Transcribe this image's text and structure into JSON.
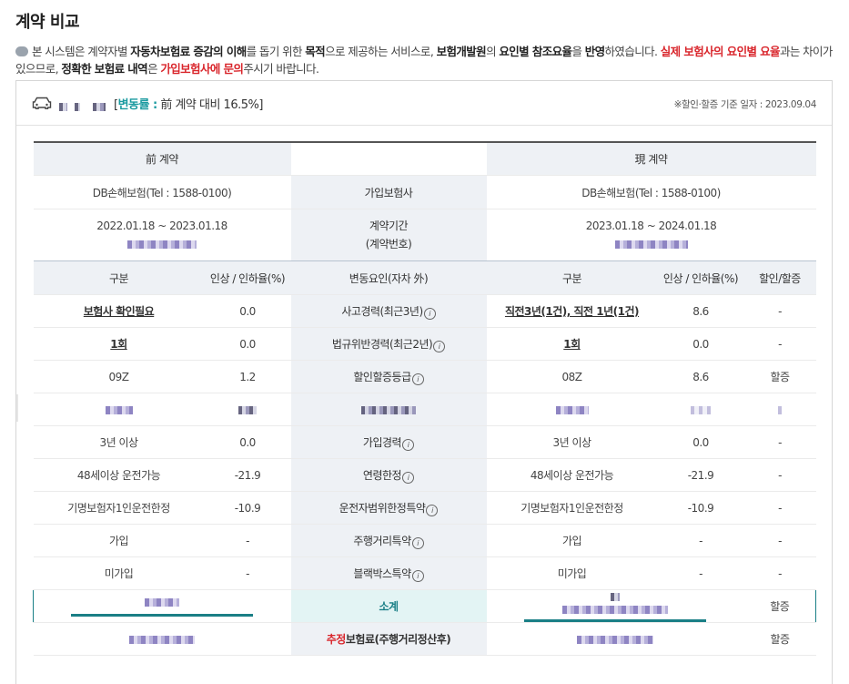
{
  "page": {
    "title": "계약 비교",
    "notice": {
      "t1": "본 시스템은 계약자별 ",
      "b1": "자동차보험료 증감의 이해",
      "t2": "를 돕기 위한 ",
      "b2": "목적",
      "t3": "으로 제공하는 서비스로, ",
      "b3": "보험개발원",
      "t4": "의 ",
      "b4": "요인별 참조요율",
      "t5": "을 ",
      "b5": "반영",
      "t6": "하였습니다. ",
      "r1": "실제 보험사의 요인별 요율",
      "t7": "과는 차이가 있으므로, ",
      "b6": "정확한 보험료 내역",
      "t8": "은 ",
      "r2": "가입보험사에 문의",
      "t9": "주시기 바랍니다."
    }
  },
  "summary": {
    "rate_prefix": "[",
    "rate_label": "변동률 :",
    "rate_text": " 前 계약 대비 16.5%]",
    "base_date": "※할인·할증 기준 일자 : 2023.09.04"
  },
  "headers": {
    "prev_contract": "前 계약",
    "curr_contract": "現 계약",
    "insurer_label": "가입보험사",
    "period_label_1": "계약기간",
    "period_label_2": "(계약번호)",
    "col_category": "구분",
    "col_rate": "인상 / 인하율(%)",
    "col_factor": "변동요인(자차 外)",
    "col_category_2": "구분",
    "col_rate_2": "인상 / 인하율(%)",
    "col_discount": "할인/할증"
  },
  "contracts": {
    "prev_insurer": "DB손해보험(Tel : 1588-0100)",
    "curr_insurer": "DB손해보험(Tel : 1588-0100)",
    "prev_period": "2022.01.18 ~ 2023.01.18",
    "curr_period": "2023.01.18 ~ 2024.01.18"
  },
  "rows": [
    {
      "prev_cat": "보험사 확인필요",
      "prev_rate": "0.0",
      "factor": "사고경력(최근3년)",
      "curr_cat": "직전3년(1건), 직전 1년(1건)",
      "curr_rate": "8.6",
      "disc": "-"
    },
    {
      "prev_cat": "1회",
      "prev_rate": "0.0",
      "factor": "법규위반경력(최근2년)",
      "curr_cat": "1회",
      "curr_rate": "0.0",
      "disc": "-"
    },
    {
      "prev_cat": "09Z",
      "prev_rate": "1.2",
      "factor": "할인할증등급",
      "curr_cat": "08Z",
      "curr_rate": "8.6",
      "disc": "할증"
    },
    {
      "prev_cat": "3년 이상",
      "prev_rate": "0.0",
      "factor": "가입경력",
      "curr_cat": "3년 이상",
      "curr_rate": "0.0",
      "disc": "-"
    },
    {
      "prev_cat": "48세이상 운전가능",
      "prev_rate": "-21.9",
      "factor": "연령한정",
      "curr_cat": "48세이상 운전가능",
      "curr_rate": "-21.9",
      "disc": "-"
    },
    {
      "prev_cat": "기명보험자1인운전한정",
      "prev_rate": "-10.9",
      "factor": "운전자범위한정특약",
      "curr_cat": "기명보험자1인운전한정",
      "curr_rate": "-10.9",
      "disc": "-"
    },
    {
      "prev_cat": "가입",
      "prev_rate": "-",
      "factor": "주행거리특약",
      "curr_cat": "가입",
      "curr_rate": "-",
      "disc": "-"
    },
    {
      "prev_cat": "미가입",
      "prev_rate": "-",
      "factor": "블랙박스특약",
      "curr_cat": "미가입",
      "curr_rate": "-",
      "disc": "-"
    }
  ],
  "subtotal": {
    "label": "소계",
    "disc": "할증"
  },
  "estimate": {
    "label_red": "추정",
    "label_rest": "보험료(주행거리정산후)",
    "disc": "할증"
  },
  "icons": {
    "notice": "speech-bubble-icon",
    "car": "car-icon",
    "info": "info-circle-icon"
  },
  "colors": {
    "accent": "#1a9aa0",
    "alert": "#d9262c",
    "teal_dark": "#1a7f86"
  }
}
